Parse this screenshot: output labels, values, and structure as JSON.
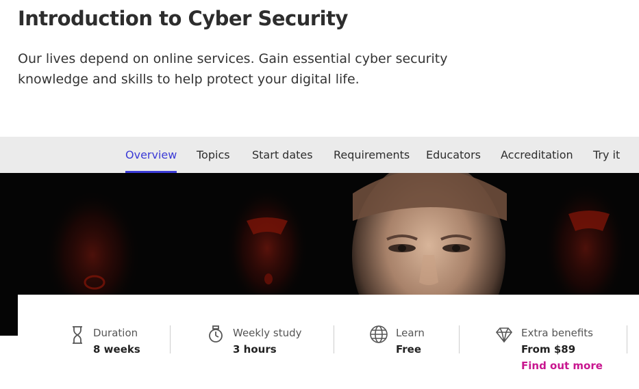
{
  "course": {
    "title": "Introduction to Cyber Security",
    "description": "Our lives depend on online services. Gain essential cyber security knowledge and skills to help protect your digital life."
  },
  "tabs": [
    {
      "label": "Overview",
      "active": true
    },
    {
      "label": "Topics",
      "active": false
    },
    {
      "label": "Start dates",
      "active": false
    },
    {
      "label": "Requirements",
      "active": false
    },
    {
      "label": "Educators",
      "active": false
    },
    {
      "label": "Accreditation",
      "active": false
    },
    {
      "label": "Try it",
      "active": false
    }
  ],
  "hero": {
    "image": "man-face-lit-by-screen-dark-background"
  },
  "stats": {
    "duration": {
      "icon": "hourglass-icon",
      "label": "Duration",
      "value": "8 weeks"
    },
    "weekly_study": {
      "icon": "stopwatch-icon",
      "label": "Weekly study",
      "value": "3 hours"
    },
    "learn": {
      "icon": "globe-icon",
      "label": "Learn",
      "value": "Free"
    },
    "extra_benefits": {
      "icon": "diamond-icon",
      "label": "Extra benefits",
      "value": "From $89",
      "link": "Find out more"
    }
  },
  "colors": {
    "accent": "#3b3bd6",
    "link": "#c8168f",
    "tabbar_bg": "#ebebeb"
  }
}
